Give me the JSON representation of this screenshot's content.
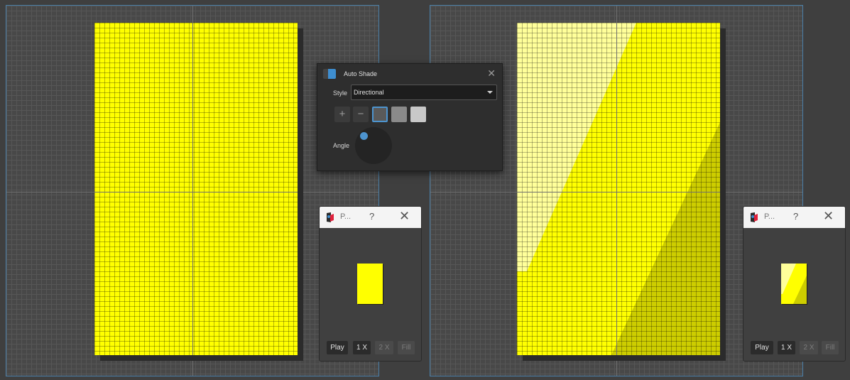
{
  "colors": {
    "sprite_yellow": "#ffff00",
    "highlight": "#ffff9a",
    "shadow": "#cdcd00",
    "selection_border": "#4a7fa8"
  },
  "auto_shade": {
    "title": "Auto Shade",
    "close_icon": "close-icon",
    "style_label": "Style",
    "style_value": "Directional",
    "add_label": "+",
    "remove_label": "−",
    "swatches": [
      "#5a5a5a",
      "#8a8a8a",
      "#c8c8c8"
    ],
    "angle_label": "Angle"
  },
  "preview_left": {
    "title": "P...",
    "help": "?",
    "close": "✕",
    "buttons": [
      "Play",
      "1 X",
      "2 X",
      "Fill"
    ]
  },
  "preview_right": {
    "title": "P...",
    "help": "?",
    "close": "✕",
    "buttons": [
      "Play",
      "1 X",
      "2 X",
      "Fill"
    ]
  }
}
